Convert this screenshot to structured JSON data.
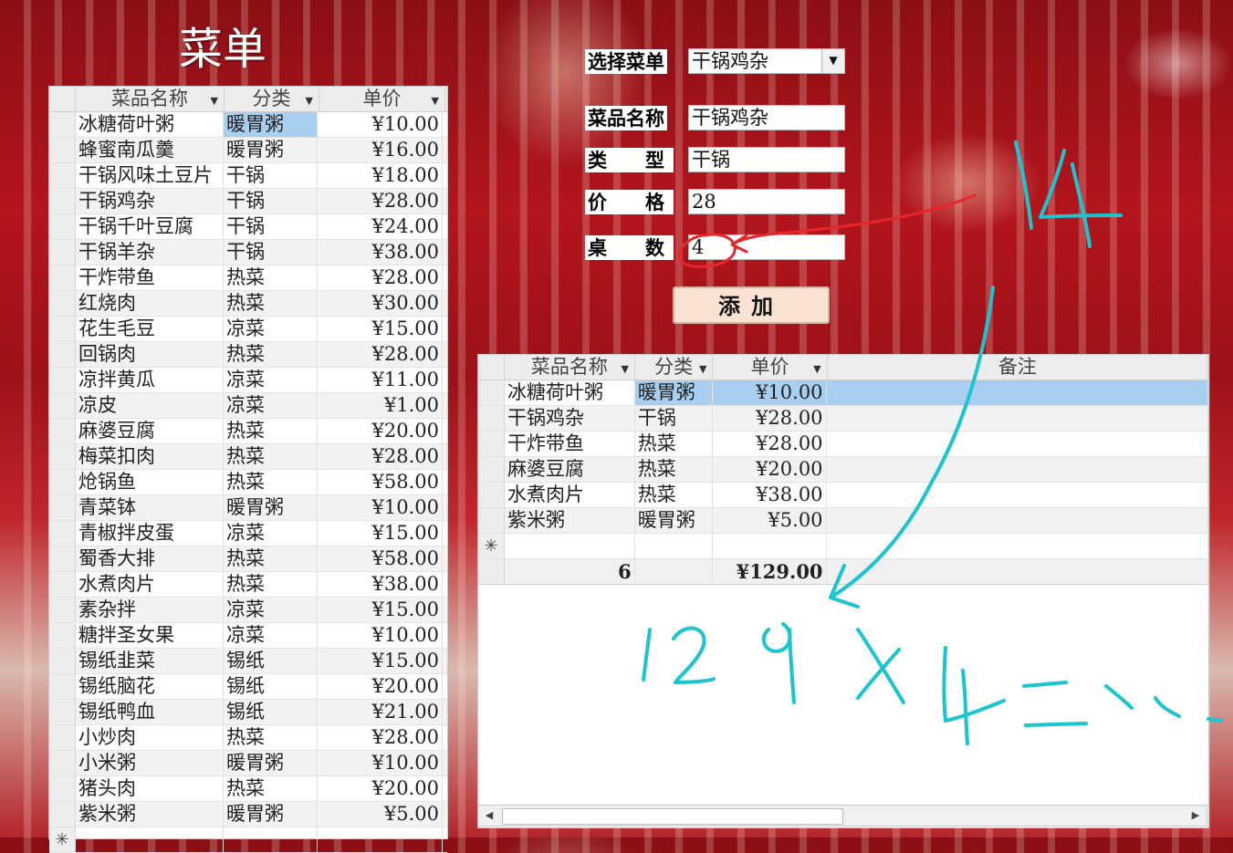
{
  "title": "菜单",
  "menu_table": {
    "headers": [
      "菜品名称",
      "分类",
      "单价"
    ],
    "rows": [
      [
        "冰糖荷叶粥",
        "暖胃粥",
        "¥10.00"
      ],
      [
        "蜂蜜南瓜羹",
        "暖胃粥",
        "¥16.00"
      ],
      [
        "干锅风味土豆片",
        "干锅",
        "¥18.00"
      ],
      [
        "干锅鸡杂",
        "干锅",
        "¥28.00"
      ],
      [
        "干锅千叶豆腐",
        "干锅",
        "¥24.00"
      ],
      [
        "干锅羊杂",
        "干锅",
        "¥38.00"
      ],
      [
        "干炸带鱼",
        "热菜",
        "¥28.00"
      ],
      [
        "红烧肉",
        "热菜",
        "¥30.00"
      ],
      [
        "花生毛豆",
        "凉菜",
        "¥15.00"
      ],
      [
        "回锅肉",
        "热菜",
        "¥28.00"
      ],
      [
        "凉拌黄瓜",
        "凉菜",
        "¥11.00"
      ],
      [
        "凉皮",
        "凉菜",
        "¥1.00"
      ],
      [
        "麻婆豆腐",
        "热菜",
        "¥20.00"
      ],
      [
        "梅菜扣肉",
        "热菜",
        "¥28.00"
      ],
      [
        "炝锅鱼",
        "热菜",
        "¥58.00"
      ],
      [
        "青菜钵",
        "暖胃粥",
        "¥10.00"
      ],
      [
        "青椒拌皮蛋",
        "凉菜",
        "¥15.00"
      ],
      [
        "蜀香大排",
        "热菜",
        "¥58.00"
      ],
      [
        "水煮肉片",
        "热菜",
        "¥38.00"
      ],
      [
        "素杂拌",
        "凉菜",
        "¥15.00"
      ],
      [
        "糖拌圣女果",
        "凉菜",
        "¥10.00"
      ],
      [
        "锡纸韭菜",
        "锡纸",
        "¥15.00"
      ],
      [
        "锡纸脑花",
        "锡纸",
        "¥20.00"
      ],
      [
        "锡纸鸭血",
        "锡纸",
        "¥21.00"
      ],
      [
        "小炒肉",
        "热菜",
        "¥28.00"
      ],
      [
        "小米粥",
        "暖胃粥",
        "¥10.00"
      ],
      [
        "猪头肉",
        "热菜",
        "¥20.00"
      ],
      [
        "紫米粥",
        "暖胃粥",
        "¥5.00"
      ]
    ],
    "new_row_marker": "✳"
  },
  "form": {
    "select_label": "选择菜单",
    "select_value": "干锅鸡杂",
    "name_label": "菜品名称",
    "name_value": "干锅鸡杂",
    "type_label": "类　　型",
    "type_value": "干锅",
    "price_label": "价　　格",
    "price_value": "28",
    "tables_label": "桌　　数",
    "tables_value": "4",
    "add_button": "添加"
  },
  "order_table": {
    "headers": [
      "菜品名称",
      "分类",
      "单价",
      "备注"
    ],
    "rows": [
      [
        "冰糖荷叶粥",
        "暖胃粥",
        "¥10.00",
        ""
      ],
      [
        "干锅鸡杂",
        "干锅",
        "¥28.00",
        ""
      ],
      [
        "干炸带鱼",
        "热菜",
        "¥28.00",
        ""
      ],
      [
        "麻婆豆腐",
        "热菜",
        "¥20.00",
        ""
      ],
      [
        "水煮肉片",
        "热菜",
        "¥38.00",
        ""
      ],
      [
        "紫米粥",
        "暖胃粥",
        "¥5.00",
        ""
      ]
    ],
    "new_row_marker": "✳",
    "total_count": "6",
    "total_price": "¥129.00"
  },
  "annotations": {
    "ink_color_cyan": "#19c6cf",
    "ink_color_red": "#e8252b",
    "handwritten_top": "14",
    "handwritten_bottom": "129 x 4 =..."
  }
}
